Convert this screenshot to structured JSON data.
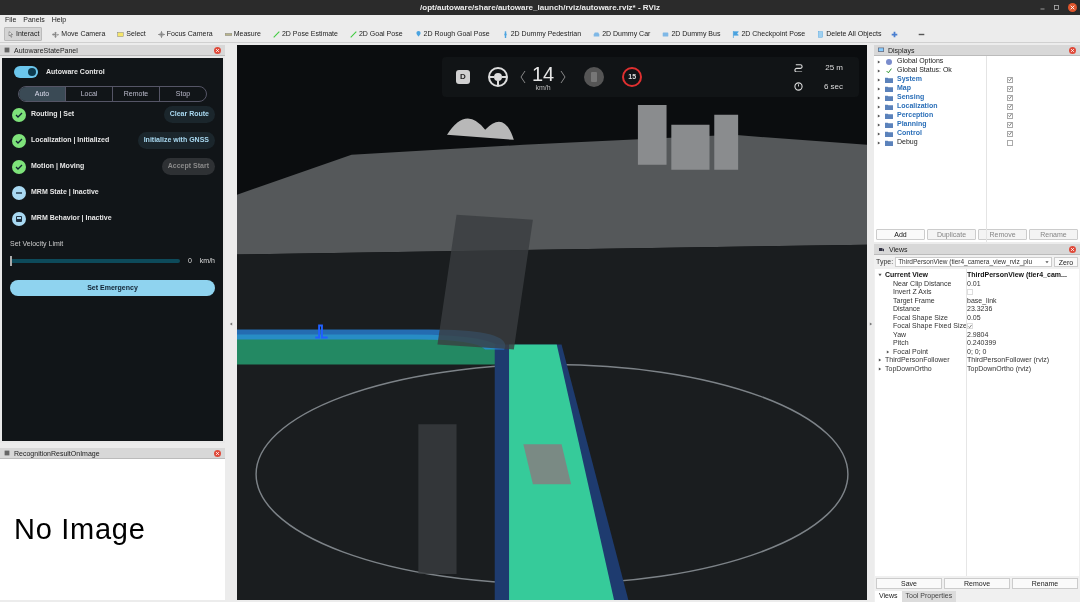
{
  "window": {
    "title": "/opt/autoware/share/autoware_launch/rviz/autoware.rviz* - RViz"
  },
  "menu": [
    "File",
    "Panels",
    "Help"
  ],
  "toolbar": [
    {
      "label": "Interact",
      "selected": true
    },
    {
      "label": "Move Camera",
      "selected": false
    },
    {
      "label": "Select",
      "selected": false
    },
    {
      "label": "Focus Camera",
      "selected": false
    },
    {
      "label": "Measure",
      "selected": false
    },
    {
      "label": "2D Pose Estimate",
      "selected": false
    },
    {
      "label": "2D Goal Pose",
      "selected": false
    },
    {
      "label": "2D Rough Goal Pose",
      "selected": false
    },
    {
      "label": "2D Dummy Pedestrian",
      "selected": false
    },
    {
      "label": "2D Dummy Car",
      "selected": false
    },
    {
      "label": "2D Dummy Bus",
      "selected": false
    },
    {
      "label": "2D Checkpoint Pose",
      "selected": false
    },
    {
      "label": "Delete All Objects",
      "selected": false
    }
  ],
  "state_panel": {
    "title": "AutowareStatePanel",
    "control": {
      "label": "Autoware Control",
      "on": true
    },
    "modes": [
      {
        "label": "Auto",
        "selected": true
      },
      {
        "label": "Local",
        "selected": false
      },
      {
        "label": "Remote",
        "selected": false
      },
      {
        "label": "Stop",
        "selected": false
      }
    ],
    "statuses": [
      {
        "label": "Routing | Set",
        "kind": "check",
        "action": {
          "label": "Clear Route",
          "disabled": false
        }
      },
      {
        "label": "Localization | Initialized",
        "kind": "check",
        "action": {
          "label": "Initialize with GNSS",
          "disabled": false
        }
      },
      {
        "label": "Motion | Moving",
        "kind": "check",
        "action": {
          "label": "Accept Start",
          "disabled": true
        }
      },
      {
        "label": "MRM State | Inactive",
        "kind": "minus"
      },
      {
        "label": "MRM Behavior | Inactive",
        "kind": "vehicle"
      }
    ],
    "velocity": {
      "label": "Set Velocity Limit",
      "level": 0,
      "value": "0",
      "unit": "km/h"
    },
    "emergency_button": "Set Emergency"
  },
  "recognition_panel": {
    "title": "RecognitionResultOnImage",
    "message": "No Image"
  },
  "hud": {
    "gear": "D",
    "speed": "14",
    "speed_unit": "km/h",
    "speed_limit": "15",
    "distance": "25 m",
    "time": "6 sec"
  },
  "displays": {
    "title": "Displays",
    "items": [
      {
        "label": "Global Options",
        "kind": "options"
      },
      {
        "label": "Global Status: Ok",
        "kind": "status"
      },
      {
        "label": "System",
        "kind": "group",
        "checked": true
      },
      {
        "label": "Map",
        "kind": "group",
        "checked": true
      },
      {
        "label": "Sensing",
        "kind": "group",
        "checked": true
      },
      {
        "label": "Localization",
        "kind": "group",
        "checked": true
      },
      {
        "label": "Perception",
        "kind": "group",
        "checked": true
      },
      {
        "label": "Planning",
        "kind": "group",
        "checked": true
      },
      {
        "label": "Control",
        "kind": "group",
        "checked": true
      },
      {
        "label": "Debug",
        "kind": "group",
        "checked": false
      }
    ],
    "buttons": [
      {
        "label": "Add",
        "disabled": false
      },
      {
        "label": "Duplicate",
        "disabled": true
      },
      {
        "label": "Remove",
        "disabled": true
      },
      {
        "label": "Rename",
        "disabled": true
      }
    ]
  },
  "views": {
    "title": "Views",
    "type_label": "Type:",
    "type_value": "ThirdPersonView (tier4_camera_view_rviz_plu",
    "zero_button": "Zero",
    "tree": [
      {
        "name": "Current View",
        "value": "ThirdPersonView (tier4_cam...",
        "expanded": true,
        "children": [
          {
            "name": "Near Clip Distance",
            "value": "0.01"
          },
          {
            "name": "Invert Z Axis",
            "kind": "checkbox",
            "checked": false
          },
          {
            "name": "Target Frame",
            "value": "base_link"
          },
          {
            "name": "Distance",
            "value": "23.3236"
          },
          {
            "name": "Focal Shape Size",
            "value": "0.05"
          },
          {
            "name": "Focal Shape Fixed Size",
            "kind": "checkbox",
            "checked": true
          },
          {
            "name": "Yaw",
            "value": "2.9804"
          },
          {
            "name": "Pitch",
            "value": "0.240399"
          },
          {
            "name": "Focal Point",
            "value": "0; 0; 0",
            "expanded": false
          }
        ]
      },
      {
        "name": "ThirdPersonFollower",
        "value": "ThirdPersonFollower (rviz)",
        "expanded": false
      },
      {
        "name": "TopDownOrtho",
        "value": "TopDownOrtho (rviz)",
        "expanded": false
      }
    ],
    "buttons": [
      "Save",
      "Remove",
      "Rename"
    ],
    "tabs": [
      {
        "label": "Views",
        "selected": true
      },
      {
        "label": "Tool Properties",
        "selected": false
      }
    ]
  }
}
